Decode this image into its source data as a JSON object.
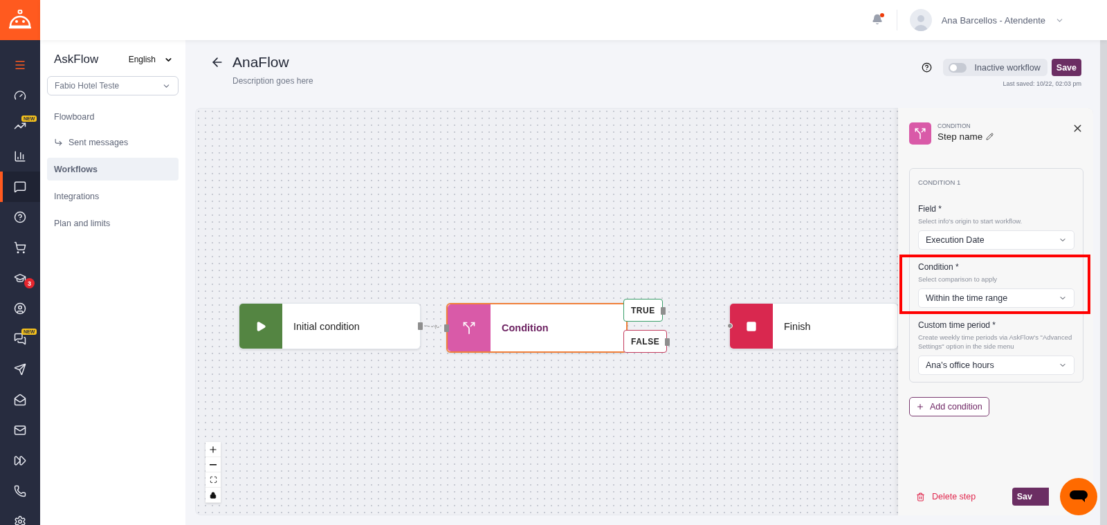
{
  "rail": {
    "items": [
      {
        "kind": "menu",
        "selected": false
      },
      {
        "kind": "gauge",
        "selected": false
      },
      {
        "kind": "trend",
        "selected": false,
        "tag": "NEW"
      },
      {
        "kind": "bars",
        "selected": false
      },
      {
        "kind": "chat",
        "selected": true
      },
      {
        "kind": "help",
        "selected": false
      },
      {
        "kind": "cart",
        "selected": false
      },
      {
        "kind": "school",
        "selected": false,
        "count": "3"
      },
      {
        "kind": "user",
        "selected": false
      },
      {
        "kind": "chats",
        "selected": false,
        "tag": "NEW"
      },
      {
        "kind": "send",
        "selected": false
      },
      {
        "kind": "mailopen",
        "selected": false
      },
      {
        "kind": "mail",
        "selected": false
      },
      {
        "kind": "forward",
        "selected": false
      },
      {
        "kind": "phone",
        "selected": false
      },
      {
        "kind": "settings",
        "selected": false
      }
    ]
  },
  "header": {
    "notifications": {
      "unread": true
    },
    "user": "Ana Barcellos - Atendente"
  },
  "sidebar": {
    "app_name": "AskFlow",
    "language": "English",
    "property": "Fabio Hotel Teste",
    "items": [
      {
        "label": "Flowboard",
        "selected": false,
        "children": [
          {
            "label": "Sent messages",
            "selected": false
          }
        ]
      },
      {
        "label": "Workflows",
        "selected": true
      },
      {
        "label": "Integrations",
        "selected": false
      },
      {
        "label": "Plan and limits",
        "selected": false
      }
    ]
  },
  "page": {
    "title": "AnaFlow",
    "description": "Description goes here",
    "toggle": {
      "label": "Inactive workflow",
      "on": false
    },
    "save": "Save",
    "last_saved": "Last saved: 10/22, 02:03 pm"
  },
  "canvas": {
    "nodes": [
      {
        "kind": "start",
        "label": "Initial condition",
        "selected": false
      },
      {
        "kind": "condition",
        "label": "Condition",
        "selected": true,
        "outputs": [
          {
            "label": "TRUE",
            "kind": "true"
          },
          {
            "label": "FALSE",
            "kind": "false"
          }
        ]
      },
      {
        "kind": "finish",
        "label": "Finish",
        "selected": false
      }
    ]
  },
  "panel": {
    "type": "CONDITION",
    "step_name": "Step name",
    "conditions": [
      {
        "title": "CONDITION 1",
        "fields": [
          {
            "label": "Field *",
            "hint": "Select info's origin to start workflow.",
            "value": "Execution Date",
            "highlighted": false
          },
          {
            "label": "Condition *",
            "hint": "Select comparison to apply",
            "value": "Within the time range",
            "highlighted": true
          },
          {
            "label": "Custom time period *",
            "hint": "Create weekly time periods via AskFlow's \"Advanced Settings\" option in the side menu",
            "value": "Ana's office hours",
            "highlighted": false
          }
        ]
      }
    ],
    "add_condition": "Add condition",
    "delete": "Delete step",
    "save": "Sav"
  }
}
